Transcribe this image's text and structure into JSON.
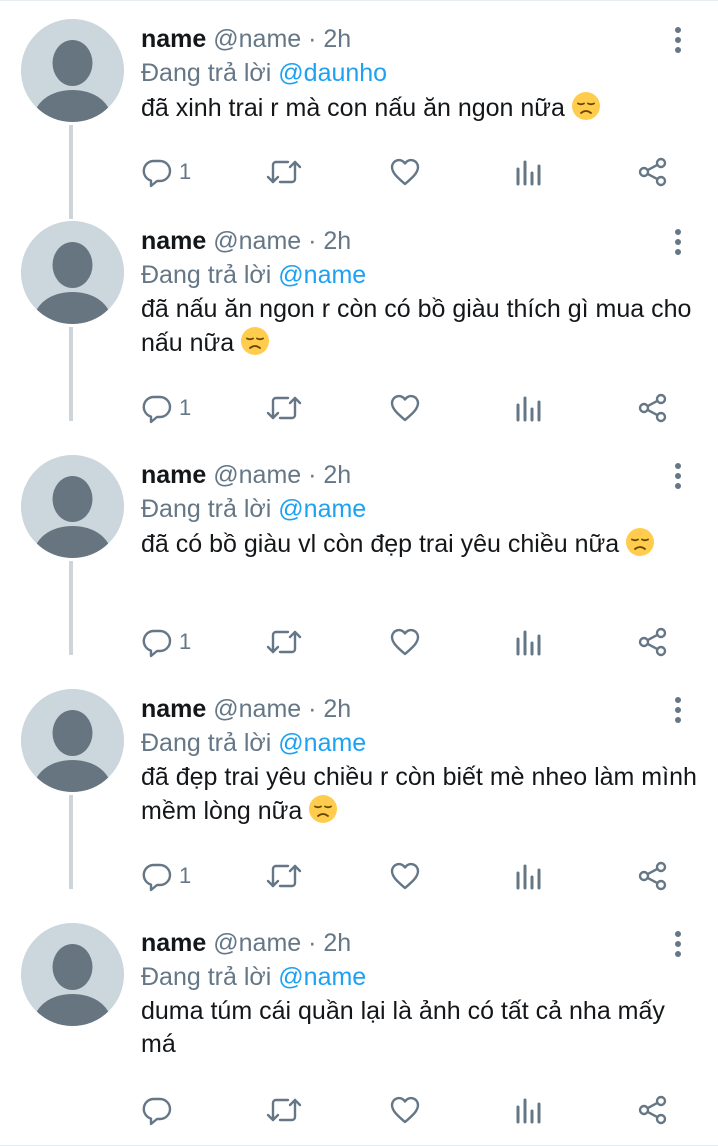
{
  "colors": {
    "name": "#14171a",
    "muted": "#657786",
    "mention": "#1da1f2",
    "avatar_bg": "#ccd6dd",
    "avatar_fg": "#66757f",
    "thread_line": "#ced5da"
  },
  "icons": [
    "more-icon",
    "reply-icon",
    "retweet-icon",
    "like-icon",
    "analytics-icon",
    "share-icon",
    "sad-face-emoji"
  ],
  "tweets": [
    {
      "display_name": "name",
      "handle": "@name",
      "dot": "·",
      "time": "2h",
      "replying_prefix": "Đang trả lời",
      "replying_to": "@daunho",
      "text": "đã xinh trai r mà con nấu ăn ngon nữa",
      "emoji": "😞",
      "reply_count": "1"
    },
    {
      "display_name": "name",
      "handle": "@name",
      "dot": "·",
      "time": "2h",
      "replying_prefix": "Đang trả lời",
      "replying_to": "@name",
      "text": "đã nấu ăn ngon r còn có bồ giàu thích gì mua cho nấu nữa",
      "emoji": "😞",
      "reply_count": "1"
    },
    {
      "display_name": "name",
      "handle": "@name",
      "dot": "·",
      "time": "2h",
      "replying_prefix": "Đang trả lời",
      "replying_to": "@name",
      "text": "đã có bồ giàu vl còn đẹp trai yêu chiều nữa",
      "emoji": "😞",
      "reply_count": "1"
    },
    {
      "display_name": "name",
      "handle": "@name",
      "dot": "·",
      "time": "2h",
      "replying_prefix": "Đang trả lời",
      "replying_to": "@name",
      "text": "đã đẹp trai yêu chiều r còn biết mè nheo làm mình mềm lòng nữa",
      "emoji": "😞",
      "reply_count": "1"
    },
    {
      "display_name": "name",
      "handle": "@name",
      "dot": "·",
      "time": "2h",
      "replying_prefix": "Đang trả lời",
      "replying_to": "@name",
      "text": "duma túm cái quần lại là ảnh có tất cả nha mấy má",
      "emoji": "",
      "reply_count": ""
    }
  ]
}
